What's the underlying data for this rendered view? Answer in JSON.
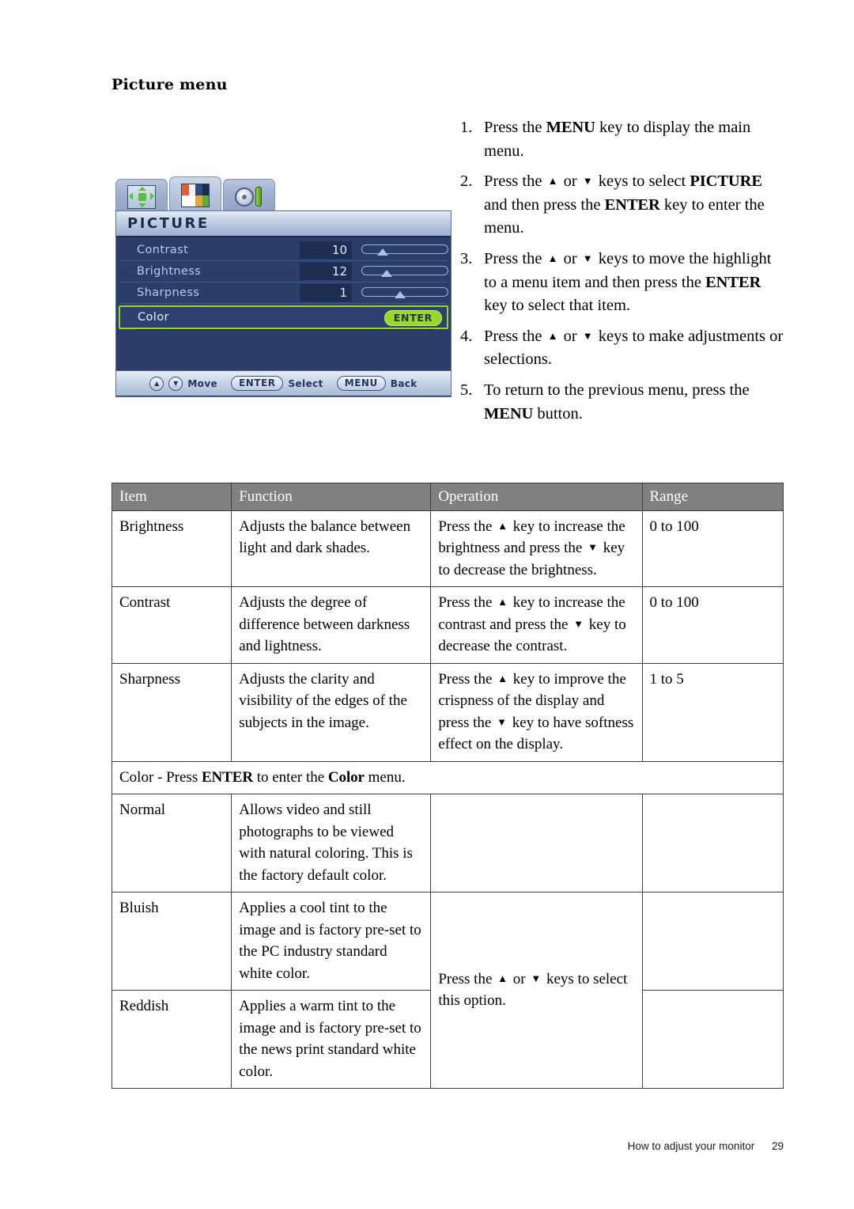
{
  "page": {
    "title": "Picture menu",
    "footer_text": "How to adjust your monitor",
    "page_number": "29"
  },
  "instructions": [
    {
      "num": "1.",
      "parts": [
        {
          "t": "text",
          "v": "Press the "
        },
        {
          "t": "bold",
          "v": "MENU"
        },
        {
          "t": "text",
          "v": " key to display the main menu."
        }
      ]
    },
    {
      "num": "2.",
      "parts": [
        {
          "t": "text",
          "v": "Press the "
        },
        {
          "t": "icon",
          "v": "arrow-up-icon"
        },
        {
          "t": "text",
          "v": " or "
        },
        {
          "t": "icon",
          "v": "arrow-down-icon"
        },
        {
          "t": "text",
          "v": " keys to select "
        },
        {
          "t": "bold",
          "v": "PICTURE"
        },
        {
          "t": "text",
          "v": " and then press the "
        },
        {
          "t": "bold",
          "v": "ENTER"
        },
        {
          "t": "text",
          "v": " key to enter the menu."
        }
      ]
    },
    {
      "num": "3.",
      "parts": [
        {
          "t": "text",
          "v": "Press the "
        },
        {
          "t": "icon",
          "v": "arrow-up-icon"
        },
        {
          "t": "text",
          "v": " or "
        },
        {
          "t": "icon",
          "v": "arrow-down-icon"
        },
        {
          "t": "text",
          "v": " keys to move the highlight to a menu item and then press the "
        },
        {
          "t": "bold",
          "v": "ENTER"
        },
        {
          "t": "text",
          "v": " key to select that item."
        }
      ]
    },
    {
      "num": "4.",
      "parts": [
        {
          "t": "text",
          "v": "Press the "
        },
        {
          "t": "icon",
          "v": "arrow-up-icon"
        },
        {
          "t": "text",
          "v": " or "
        },
        {
          "t": "icon",
          "v": "arrow-down-icon"
        },
        {
          "t": "text",
          "v": " keys to make adjustments or selections."
        }
      ]
    },
    {
      "num": "5.",
      "parts": [
        {
          "t": "text",
          "v": "To return to the previous menu, press the "
        },
        {
          "t": "bold",
          "v": "MENU"
        },
        {
          "t": "text",
          "v": " button."
        }
      ]
    }
  ],
  "osd": {
    "tabs": [
      {
        "name": "display-tab",
        "icon": "move-arrows-icon",
        "active": false
      },
      {
        "name": "picture-tab",
        "icon": "color-bars-icon",
        "active": true
      },
      {
        "name": "system-tab",
        "icon": "gear-tool-icon",
        "active": false
      }
    ],
    "title": "PICTURE",
    "rows": [
      {
        "label": "Contrast",
        "value": "10",
        "slider": 18,
        "highlight": false
      },
      {
        "label": "Brightness",
        "value": "12",
        "slider": 22,
        "highlight": false
      },
      {
        "label": "Sharpness",
        "value": "1",
        "slider": 38,
        "highlight": false
      },
      {
        "label": "Color",
        "value": "",
        "enter": "ENTER",
        "highlight": true
      }
    ],
    "footer": {
      "up_key": "▲",
      "down_key": "▼",
      "move_label": "Move",
      "enter_key": "ENTER",
      "select_label": "Select",
      "menu_key": "MENU",
      "back_label": "Back"
    },
    "colors": {
      "highlight_green": "#9AD726",
      "panel_navy": "#2A3E69",
      "label_blue": "#B8CBE8",
      "titlebar_light": "#C3D0E4"
    }
  },
  "table": {
    "headers": [
      "Item",
      "Function",
      "Operation",
      "Range"
    ],
    "rows": [
      {
        "type": "data",
        "item": "Brightness",
        "function": "Adjusts the balance between light and dark shades.",
        "operation_parts": [
          {
            "t": "text",
            "v": "Press the "
          },
          {
            "t": "icon",
            "v": "arrow-up-icon"
          },
          {
            "t": "text",
            "v": " key to increase the brightness and press the "
          },
          {
            "t": "icon",
            "v": "arrow-down-icon"
          },
          {
            "t": "text",
            "v": " key to decrease the brightness."
          }
        ],
        "range": "0 to 100"
      },
      {
        "type": "data",
        "item": "Contrast",
        "function": "Adjusts the degree of difference between darkness and lightness.",
        "operation_parts": [
          {
            "t": "text",
            "v": "Press the "
          },
          {
            "t": "icon",
            "v": "arrow-up-icon"
          },
          {
            "t": "text",
            "v": " key to increase the contrast and press the "
          },
          {
            "t": "icon",
            "v": "arrow-down-icon"
          },
          {
            "t": "text",
            "v": " key to decrease the contrast."
          }
        ],
        "range": "0 to 100"
      },
      {
        "type": "data",
        "item": "Sharpness",
        "function": "Adjusts the clarity and visibility of the edges of the subjects in the image.",
        "operation_parts": [
          {
            "t": "text",
            "v": "Press the "
          },
          {
            "t": "icon",
            "v": "arrow-up-icon"
          },
          {
            "t": "text",
            "v": " key to improve the crispness of the display and press the "
          },
          {
            "t": "icon",
            "v": "arrow-down-icon"
          },
          {
            "t": "text",
            "v": " key to have softness effect on the display."
          }
        ],
        "range": "1 to 5"
      },
      {
        "type": "span",
        "parts": [
          {
            "t": "text",
            "v": "Color - Press "
          },
          {
            "t": "bold",
            "v": "ENTER"
          },
          {
            "t": "text",
            "v": " to enter the "
          },
          {
            "t": "bold",
            "v": "Color"
          },
          {
            "t": "text",
            "v": " menu."
          }
        ]
      },
      {
        "type": "data",
        "item": "Normal",
        "function": "Allows video and still photographs to be viewed with natural coloring. This is the factory default color.",
        "operation_parts": [],
        "range": ""
      },
      {
        "type": "data",
        "item": "Bluish",
        "function": "Applies a cool tint to the image and is factory pre-set to the PC industry standard white color.",
        "operation_parts": [
          {
            "t": "text",
            "v": "Press the "
          },
          {
            "t": "icon",
            "v": "arrow-up-icon"
          },
          {
            "t": "text",
            "v": " or "
          },
          {
            "t": "icon",
            "v": "arrow-down-icon"
          },
          {
            "t": "text",
            "v": " keys to select this option."
          }
        ],
        "operation_rowspan": 2,
        "range": ""
      },
      {
        "type": "data",
        "item": "Reddish",
        "function": "Applies a warm tint to the image and is factory pre-set to the news print standard white color.",
        "operation_skip": true,
        "range": ""
      }
    ]
  }
}
